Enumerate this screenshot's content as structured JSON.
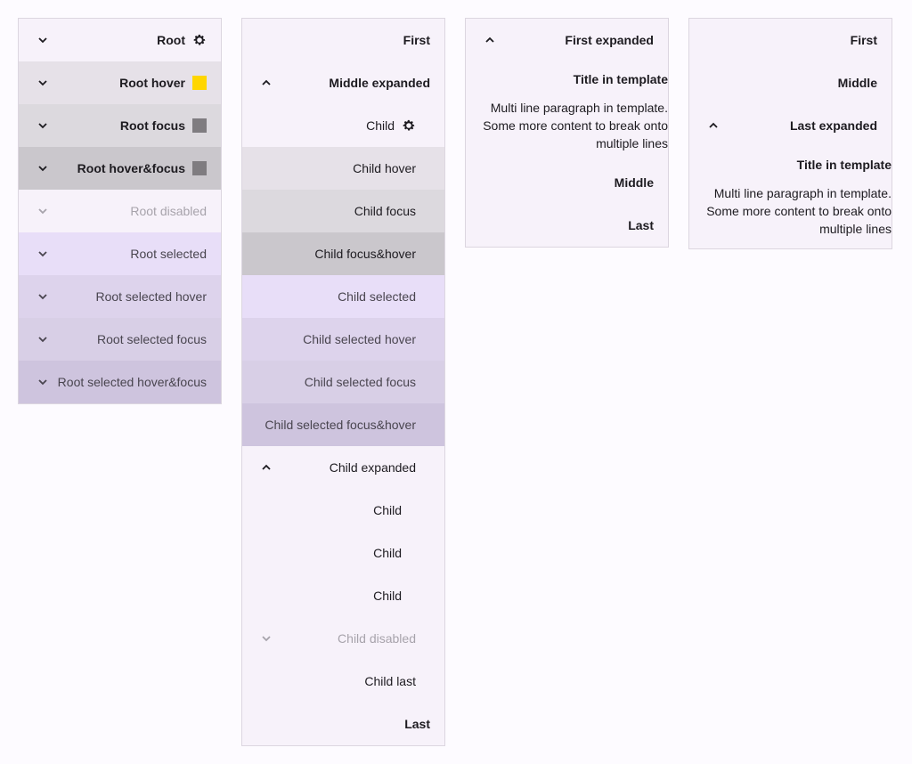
{
  "col1": {
    "items": [
      {
        "label": "Root"
      },
      {
        "label": "Root hover"
      },
      {
        "label": "Root focus"
      },
      {
        "label": "Root hover&focus"
      },
      {
        "label": "Root disabled"
      },
      {
        "label": "Root selected"
      },
      {
        "label": "Root selected hover"
      },
      {
        "label": "Root selected focus"
      },
      {
        "label": "Root selected hover&focus"
      }
    ],
    "hover_swatch_color": "#ffd600",
    "focus_swatch_color": "#7f7c80"
  },
  "col2": {
    "first": "First",
    "middle_expanded": "Middle expanded",
    "child": "Child",
    "child_hover": "Child hover",
    "child_focus": "Child focus",
    "child_focus_hover": "Child focus&hover",
    "child_selected": "Child selected",
    "child_selected_hover": "Child selected hover",
    "child_selected_focus": "Child selected focus",
    "child_selected_focus_hover": "Child selected focus&hover",
    "child_expanded": "Child expanded",
    "grandchildren": [
      "Child",
      "Child",
      "Child"
    ],
    "child_disabled": "Child disabled",
    "child_last": "Child last",
    "last": "Last"
  },
  "col3": {
    "first_expanded": "First expanded",
    "template_title": "Title in template",
    "template_para": "Multi line paragraph in template. Some more content to break onto multiple lines",
    "middle": "Middle",
    "last": "Last"
  },
  "col4": {
    "first": "First",
    "middle": "Middle",
    "last_expanded": "Last expanded",
    "template_title": "Title in template",
    "template_para": "Multi line paragraph in template. Some more content to break onto multiple lines"
  }
}
